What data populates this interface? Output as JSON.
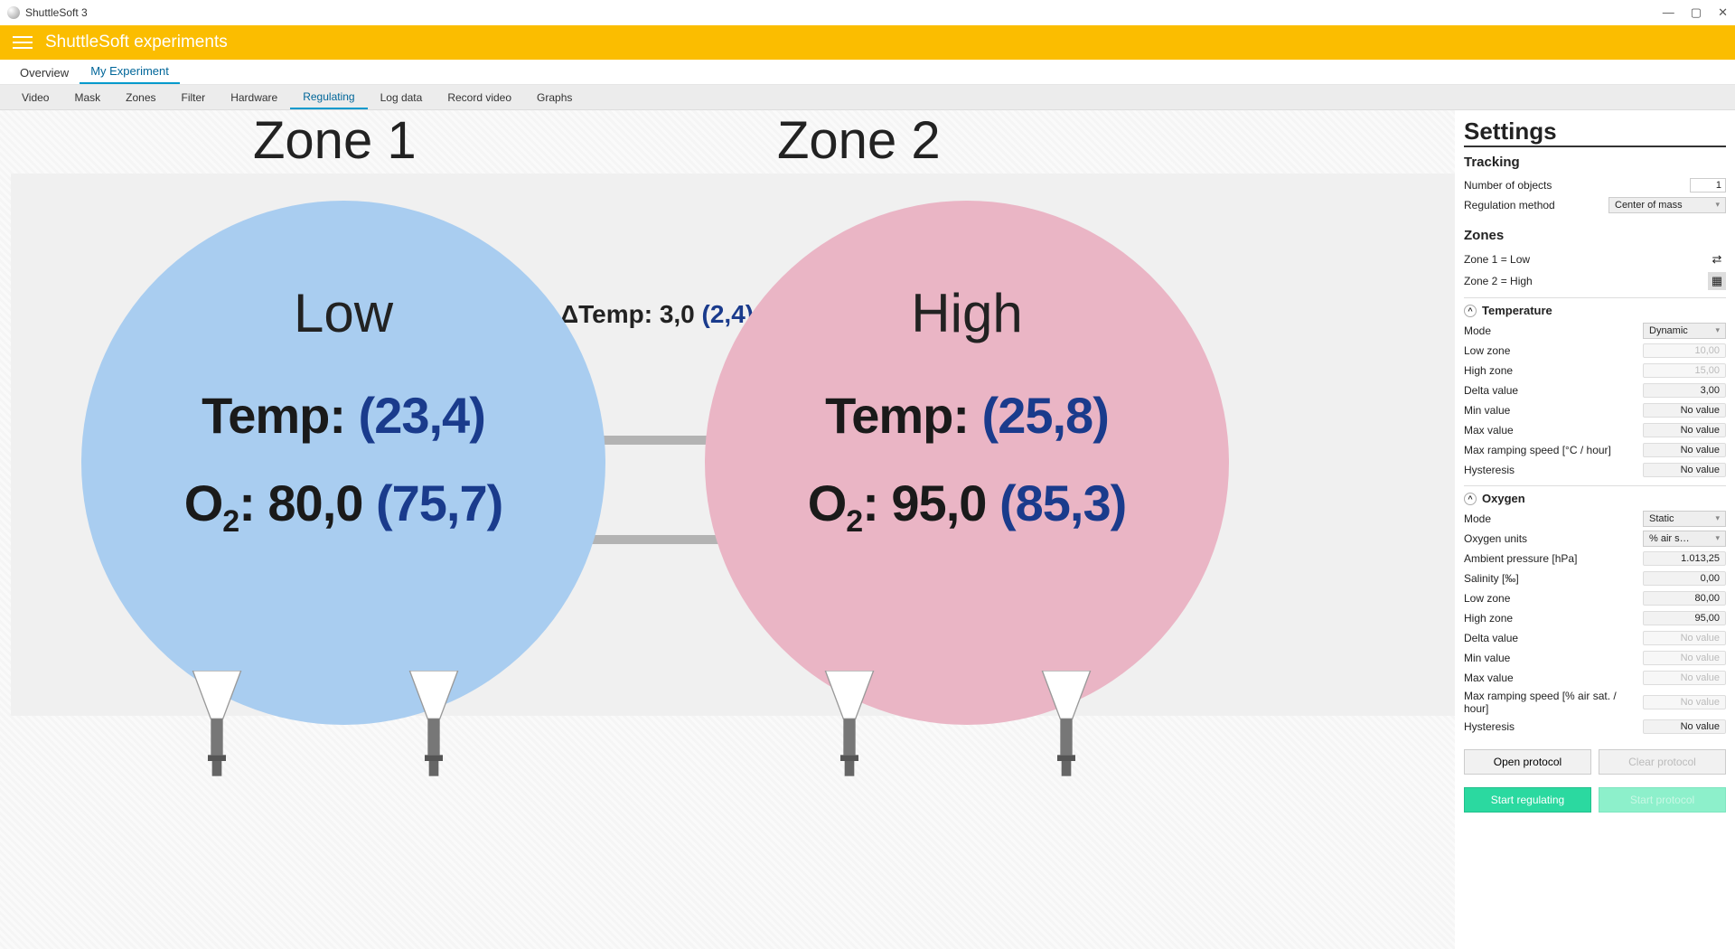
{
  "window": {
    "title": "ShuttleSoft 3"
  },
  "appbar": {
    "title": "ShuttleSoft experiments"
  },
  "tabs": {
    "items": [
      "Overview",
      "My Experiment"
    ],
    "active": 1
  },
  "subtabs": {
    "items": [
      "Video",
      "Mask",
      "Zones",
      "Filter",
      "Hardware",
      "Regulating",
      "Log data",
      "Record video",
      "Graphs"
    ],
    "active": 5
  },
  "zones": {
    "z1": {
      "title": "Zone 1",
      "label": "Low",
      "temp_label": "Temp: ",
      "temp_meas": "(23,4)",
      "o2_label": "O",
      "o2_sub": "2",
      "o2_set": ": 80,0 ",
      "o2_meas": "(75,7)"
    },
    "z2": {
      "title": "Zone 2",
      "label": "High",
      "temp_label": "Temp: ",
      "temp_meas": "(25,8)",
      "o2_label": "O",
      "o2_sub": "2",
      "o2_set": ": 95,0 ",
      "o2_meas": "(85,3)"
    },
    "delta": {
      "label": "ΔTemp: ",
      "set": "3,0 ",
      "meas": "(2,4)"
    }
  },
  "settings": {
    "title": "Settings",
    "tracking": {
      "title": "Tracking",
      "num_objects_label": "Number of objects",
      "num_objects_value": "1",
      "reg_method_label": "Regulation method",
      "reg_method_value": "Center of mass"
    },
    "zones_section": {
      "title": "Zones",
      "z1_label": "Zone 1 = Low",
      "z2_label": "Zone 2 = High"
    },
    "temperature": {
      "title": "Temperature",
      "mode_label": "Mode",
      "mode_value": "Dynamic",
      "low_label": "Low zone",
      "low_value": "10,00",
      "high_label": "High zone",
      "high_value": "15,00",
      "delta_label": "Delta value",
      "delta_value": "3,00",
      "min_label": "Min value",
      "min_value": "No value",
      "max_label": "Max value",
      "max_value": "No value",
      "ramp_label": "Max ramping speed [°C / hour]",
      "ramp_value": "No value",
      "hyst_label": "Hysteresis",
      "hyst_value": "No value"
    },
    "oxygen": {
      "title": "Oxygen",
      "mode_label": "Mode",
      "mode_value": "Static",
      "units_label": "Oxygen units",
      "units_value": "% air s…",
      "press_label": "Ambient pressure [hPa]",
      "press_value": "1.013,25",
      "sal_label": "Salinity [‰]",
      "sal_value": "0,00",
      "low_label": "Low zone",
      "low_value": "80,00",
      "high_label": "High zone",
      "high_value": "95,00",
      "delta_label": "Delta value",
      "delta_value": "No value",
      "min_label": "Min value",
      "min_value": "No value",
      "max_label": "Max value",
      "max_value": "No value",
      "ramp_label": "Max ramping speed [% air sat. / hour]",
      "ramp_value": "No value",
      "hyst_label": "Hysteresis",
      "hyst_value": "No value"
    },
    "buttons": {
      "open": "Open protocol",
      "clear": "Clear protocol",
      "start_reg": "Start regulating",
      "start_prot": "Start protocol"
    }
  }
}
